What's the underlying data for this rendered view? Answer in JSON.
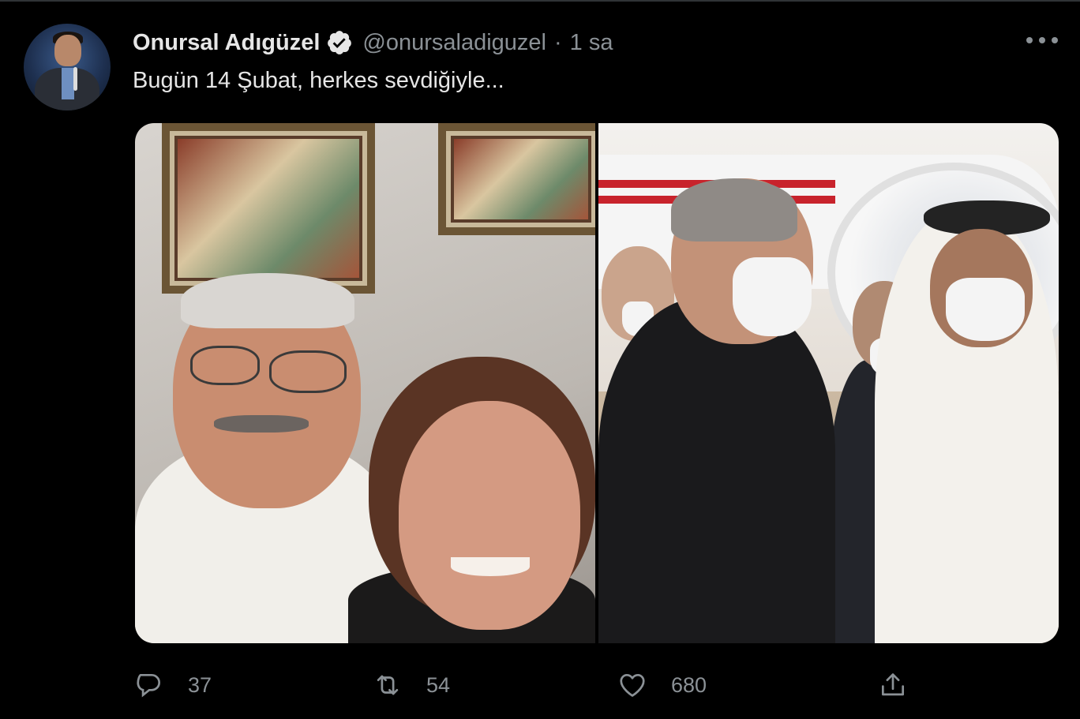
{
  "author": {
    "name": "Onursal Adıgüzel",
    "handle": "@onursaladiguzel",
    "separator": "·",
    "time": "1 sa",
    "verified": true
  },
  "tweet": {
    "text": "Bugün 14 Şubat, herkes sevdiğiyle..."
  },
  "actions": {
    "reply_count": "37",
    "retweet_count": "54",
    "like_count": "680"
  },
  "icons": {
    "verified": "verified-badge-icon",
    "more": "more-options-icon",
    "reply": "reply-icon",
    "retweet": "retweet-icon",
    "like": "heart-icon",
    "share": "share-icon"
  },
  "colors": {
    "background": "#000000",
    "text_primary": "#e6e6e6",
    "text_secondary": "#8b9196",
    "verified_badge": "#e6e6e6"
  }
}
